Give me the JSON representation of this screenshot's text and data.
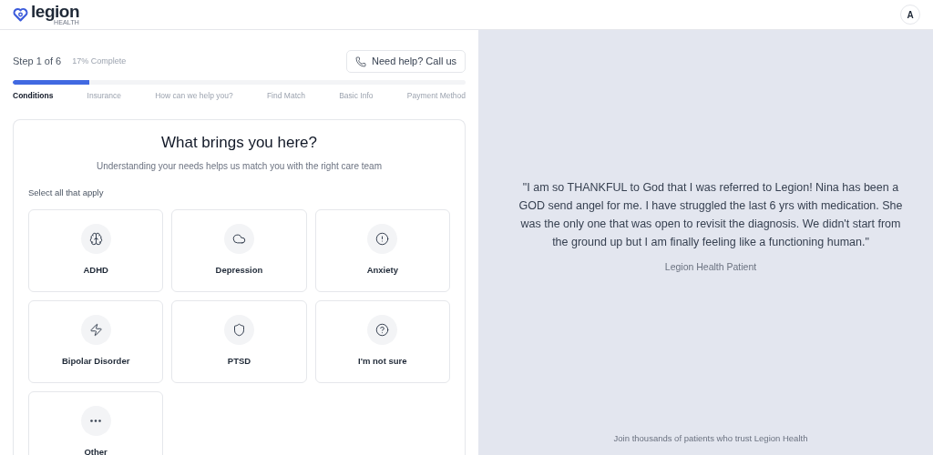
{
  "header": {
    "logo": {
      "name": "legion",
      "tagline": "HEALTH"
    },
    "avatar": "A"
  },
  "progress": {
    "step": "Step 1 of 6",
    "complete": "17% Complete",
    "help_button": "Need help? Call us",
    "level": 0.17,
    "steps": [
      {
        "label": "Conditions",
        "selected": true
      },
      {
        "label": "Insurance",
        "selected": false
      },
      {
        "label": "How can we help you?",
        "selected": false
      },
      {
        "label": "Find Match",
        "selected": false
      },
      {
        "label": "Basic Info",
        "selected": false
      },
      {
        "label": "Payment Method",
        "selected": false
      }
    ]
  },
  "question": {
    "title": "What brings you here?",
    "subtitle": "Understanding your needs helps us match you with the right care team",
    "instruction": "Select all that apply",
    "options": [
      {
        "label": "ADHD",
        "selected": false
      },
      {
        "label": "Depression",
        "selected": false
      },
      {
        "label": "Anxiety",
        "selected": false
      },
      {
        "label": "Bipolar Disorder",
        "selected": false
      },
      {
        "label": "PTSD",
        "selected": false
      },
      {
        "label": "I'm not sure",
        "selected": false
      },
      {
        "label": "Other",
        "selected": false
      }
    ]
  },
  "testimonial": {
    "quote": "\"I am so THANKFUL to God that I was referred to Legion! Nina has been a GOD send angel for me. I have struggled the last 6 yrs with medication. She was the only one that was open to revisit the diagnosis. We didn't start from the ground up but I am finally feeling like a functioning human.\"",
    "author": "Legion Health Patient",
    "footer": "Join thousands of patients who trust Legion Health"
  }
}
